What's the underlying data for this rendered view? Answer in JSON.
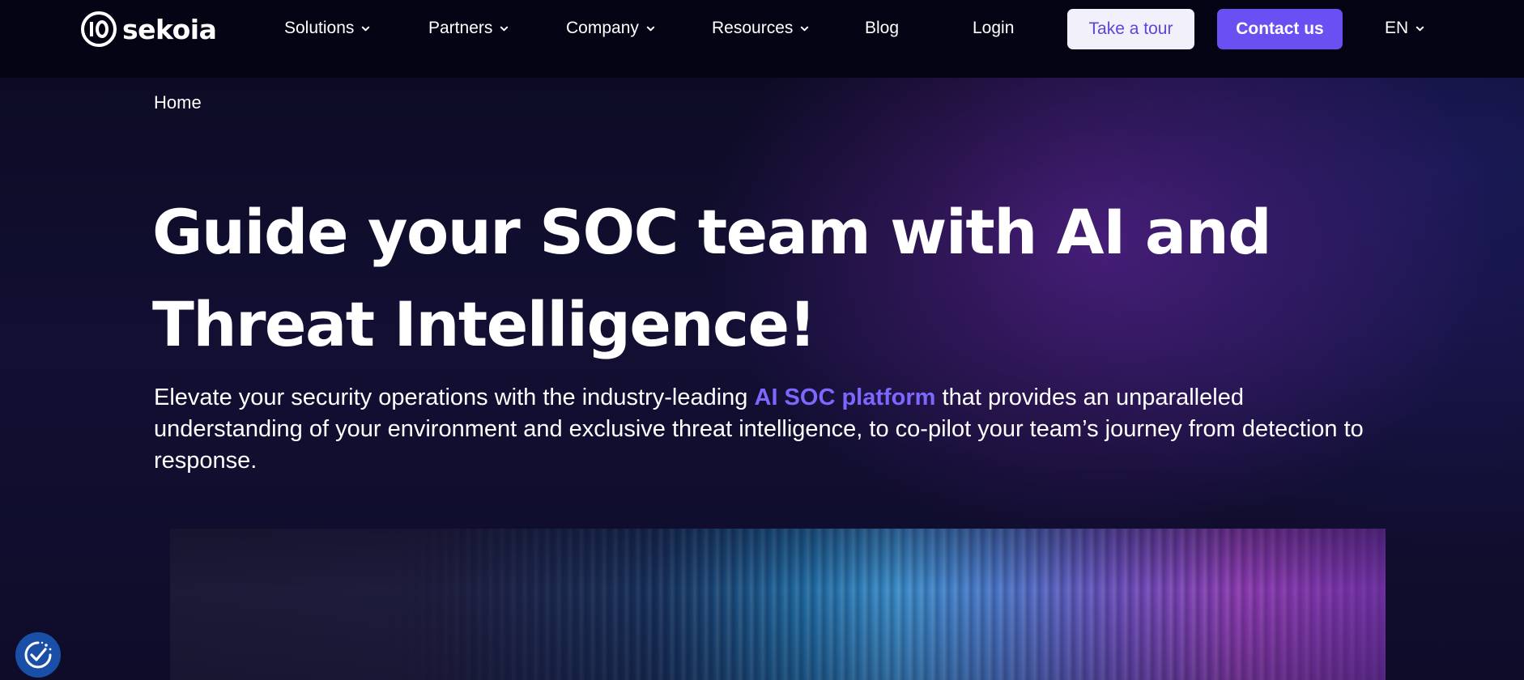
{
  "header": {
    "logo_text": "sekoia",
    "nav": [
      {
        "label": "Solutions",
        "has_dropdown": true
      },
      {
        "label": "Partners",
        "has_dropdown": true
      },
      {
        "label": "Company",
        "has_dropdown": true
      },
      {
        "label": "Resources",
        "has_dropdown": true
      },
      {
        "label": "Blog",
        "has_dropdown": false
      },
      {
        "label": "Login",
        "has_dropdown": false
      }
    ],
    "tour_button": "Take a tour",
    "contact_button": "Contact us",
    "language": "EN"
  },
  "breadcrumb": "Home",
  "hero": {
    "headline_line1": "Guide your SOC team with AI and",
    "headline_line2": "Threat Intelligence!",
    "sub_before": "Elevate your security operations with the industry-leading ",
    "sub_link": "AI SOC platform",
    "sub_after": " that provides an unparalleled understanding of your environment and exclusive threat intelligence, to co-pilot your team’s journey from detection to response."
  },
  "icons": {
    "dropdown": "chevron-down-icon",
    "consent": "cookie-consent-check-icon"
  },
  "colors": {
    "accent": "#6a4ff3",
    "link": "#7c67ff",
    "tour_text": "#5a46d8",
    "nav_bg": "#050414",
    "page_bg": "#0c0a22"
  }
}
